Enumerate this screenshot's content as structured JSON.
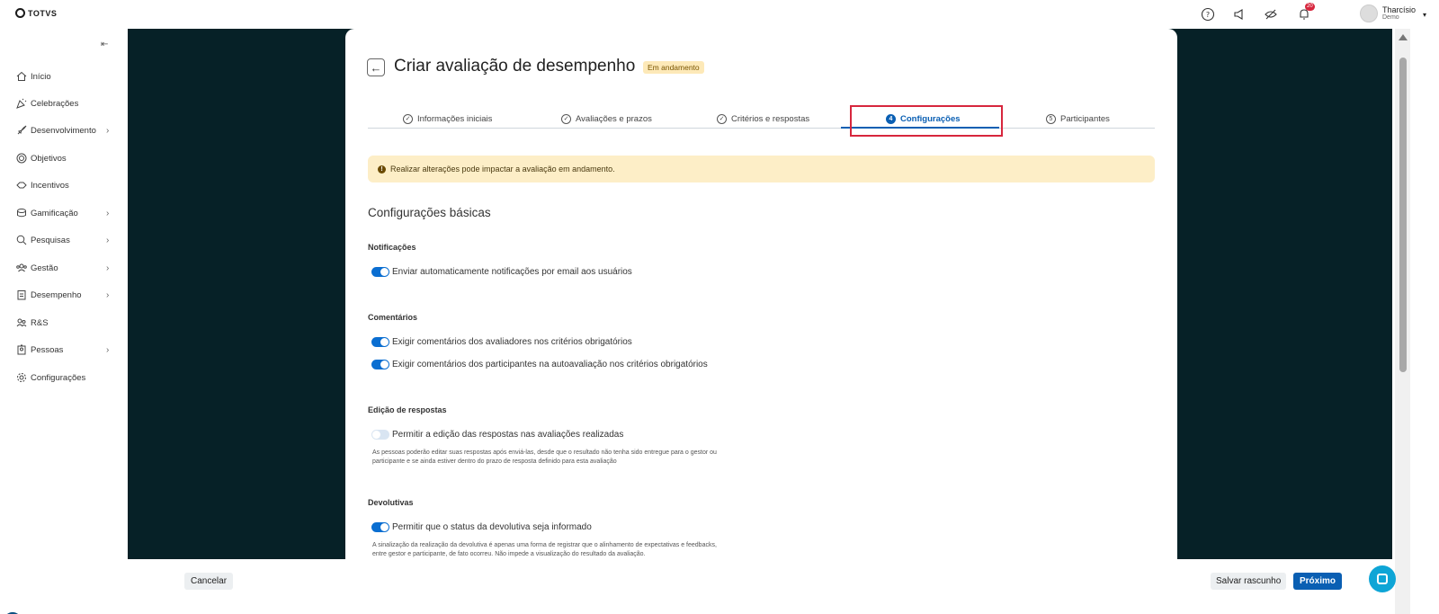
{
  "brand": {
    "logo_text": "TOTVS"
  },
  "topbar": {
    "icons": [
      "help-icon",
      "megaphone-icon",
      "eye-off-icon",
      "bell-icon"
    ],
    "notification_count": "20",
    "user_name": "Tharcísio",
    "user_org": "Demo"
  },
  "sidebar": {
    "items": [
      {
        "label": "Início",
        "icon": "home-icon",
        "has_submenu": false
      },
      {
        "label": "Celebrações",
        "icon": "party-icon",
        "has_submenu": false
      },
      {
        "label": "Desenvolvimento",
        "icon": "rocket-icon",
        "has_submenu": true
      },
      {
        "label": "Objetivos",
        "icon": "target-icon",
        "has_submenu": false
      },
      {
        "label": "Incentivos",
        "icon": "handshake-icon",
        "has_submenu": false
      },
      {
        "label": "Gamificação",
        "icon": "coins-icon",
        "has_submenu": true
      },
      {
        "label": "Pesquisas",
        "icon": "search-icon",
        "has_submenu": true
      },
      {
        "label": "Gestão",
        "icon": "team-icon",
        "has_submenu": true
      },
      {
        "label": "Desempenho",
        "icon": "clipboard-icon",
        "has_submenu": true
      },
      {
        "label": "R&S",
        "icon": "people-icon",
        "has_submenu": false
      },
      {
        "label": "Pessoas",
        "icon": "badge-icon",
        "has_submenu": true
      },
      {
        "label": "Configurações",
        "icon": "gear-icon",
        "has_submenu": false
      }
    ]
  },
  "page": {
    "title": "Criar avaliação de desempenho",
    "status": "Em andamento",
    "steps": [
      {
        "label": "Informações iniciais",
        "marker": "✓",
        "state": "done"
      },
      {
        "label": "Avaliações e prazos",
        "marker": "✓",
        "state": "done"
      },
      {
        "label": "Critérios e respostas",
        "marker": "✓",
        "state": "done"
      },
      {
        "label": "Configurações",
        "marker": "4",
        "state": "active"
      },
      {
        "label": "Participantes",
        "marker": "5",
        "state": "pending"
      }
    ],
    "warning": "Realizar alterações pode impactar a avaliação em andamento.",
    "section_title": "Configurações básicas",
    "groups": {
      "notificacoes": {
        "title": "Notificações",
        "toggles": [
          {
            "label": "Enviar automaticamente notificações por email aos usuários",
            "on": true
          }
        ]
      },
      "comentarios": {
        "title": "Comentários",
        "toggles": [
          {
            "label": "Exigir comentários dos avaliadores nos critérios obrigatórios",
            "on": true
          },
          {
            "label": "Exigir comentários dos participantes na autoavaliação nos critérios obrigatórios",
            "on": true
          }
        ]
      },
      "edicao": {
        "title": "Edição de respostas",
        "toggles": [
          {
            "label": "Permitir a edição das respostas nas avaliações realizadas",
            "on": false
          }
        ],
        "help_line1": "As pessoas poderão editar suas respostas após enviá-las, desde que o resultado não tenha sido entregue para o gestor ou",
        "help_line2": "participante e se ainda estiver dentro do prazo de resposta definido para esta avaliação"
      },
      "devolutivas": {
        "title": "Devolutivas",
        "toggles": [
          {
            "label": "Permitir que o status da devolutiva seja informado",
            "on": true
          }
        ],
        "help_line1": "A sinalização da realização da devolutiva é apenas uma forma de registrar que o alinhamento de expectativas e feedbacks,",
        "help_line2": "entre gestor e participante, de fato ocorreu. Não impede a visualização do resultado da avaliação."
      }
    }
  },
  "footer": {
    "cancel_label": "Cancelar",
    "draft_label": "Salvar rascunho",
    "next_label": "Próximo"
  },
  "colors": {
    "primary": "#0a5fb3",
    "highlight": "#d7263d",
    "backdrop": "#062127",
    "warning_bg": "#fdeec7"
  }
}
